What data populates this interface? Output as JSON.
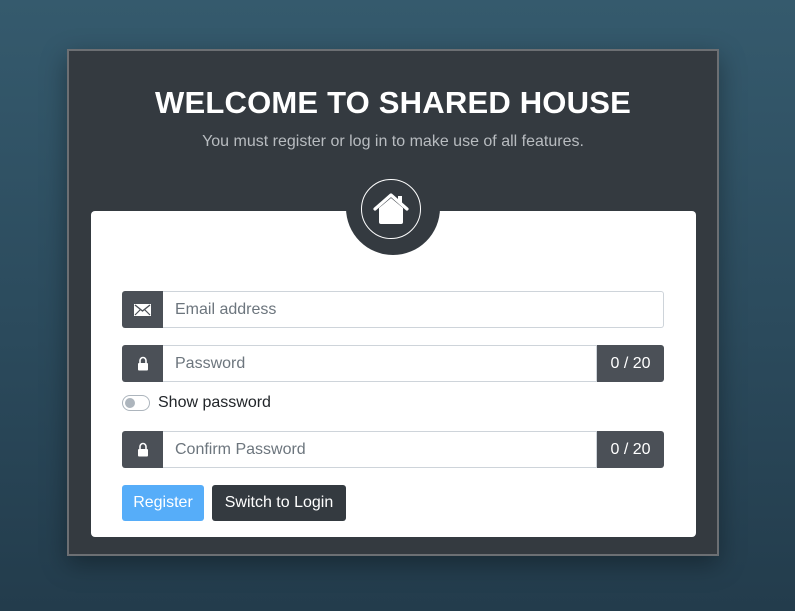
{
  "header": {
    "title": "WELCOME TO SHARED HOUSE",
    "subtitle": "You must register or log in to make use of all features."
  },
  "logo": {
    "icon": "house-icon"
  },
  "form": {
    "email": {
      "placeholder": "Email address",
      "value": "",
      "icon": "envelope-icon"
    },
    "password": {
      "placeholder": "Password",
      "value": "",
      "icon": "lock-icon",
      "counter": "0 / 20"
    },
    "show_password": {
      "label": "Show password",
      "checked": false
    },
    "confirm_password": {
      "placeholder": "Confirm Password",
      "value": "",
      "icon": "lock-icon",
      "counter": "0 / 20"
    }
  },
  "buttons": {
    "register_label": "Register",
    "switch_label": "Switch to Login"
  },
  "colors": {
    "panel": "#343a40",
    "primary": "#56adf9",
    "addon": "#4b5057"
  }
}
